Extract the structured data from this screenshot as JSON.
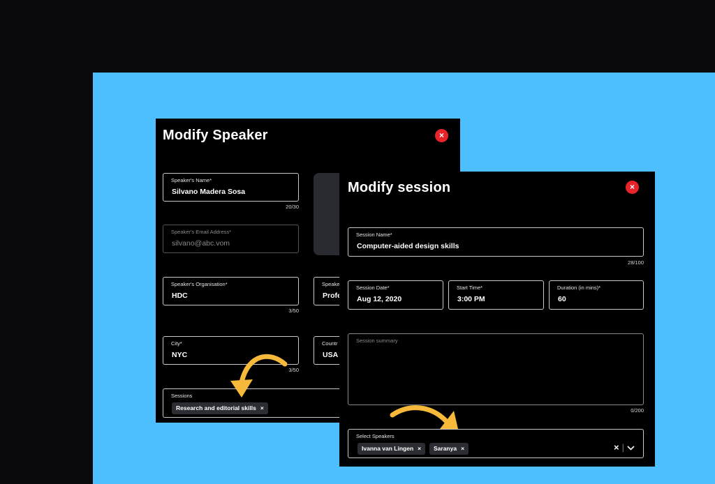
{
  "speaker_modal": {
    "title": "Modify Speaker",
    "close_label": "×",
    "name": {
      "label": "Speaker's Name*",
      "value": "Silvano Madera Sosa",
      "counter": "20/30"
    },
    "email": {
      "label": "Speaker's Email Address*",
      "value": "silvano@abc.vom"
    },
    "organisation": {
      "label": "Speaker's Organisation*",
      "value": "HDC",
      "counter": "3/50"
    },
    "position": {
      "label": "Speake",
      "value": "Profe"
    },
    "city": {
      "label": "City*",
      "value": "NYC",
      "counter": "3/50"
    },
    "country": {
      "label": "Countr",
      "value": "USA"
    },
    "sessions": {
      "label": "Sessions",
      "chips": [
        {
          "label": "Research and editorial skills",
          "remove": "×"
        }
      ]
    }
  },
  "session_modal": {
    "title": "Modify session",
    "close_label": "×",
    "session_name": {
      "label": "Session Name*",
      "value": "Computer-aided design skills",
      "counter": "28/100"
    },
    "session_date": {
      "label": "Session Date*",
      "value": "Aug 12, 2020"
    },
    "start_time": {
      "label": "Start Time*",
      "value": "3:00 PM"
    },
    "duration": {
      "label": "Duration (in mins)*",
      "value": "60"
    },
    "summary": {
      "label": "Session summary",
      "counter": "0/200"
    },
    "speakers": {
      "label": "Select Speakers",
      "chips": [
        {
          "label": "Ivanna van Lingen",
          "remove": "×"
        },
        {
          "label": "Saranya",
          "remove": "×"
        }
      ],
      "clear_label": "×",
      "separator": "|",
      "dropdown_icon": "chevron-down-icon"
    }
  },
  "colors": {
    "background": "#0a0a0c",
    "accent_blue": "#4dbfff",
    "modal_bg": "#000000",
    "close_red": "#e8242a",
    "arrow_yellow": "#f7b93a"
  }
}
